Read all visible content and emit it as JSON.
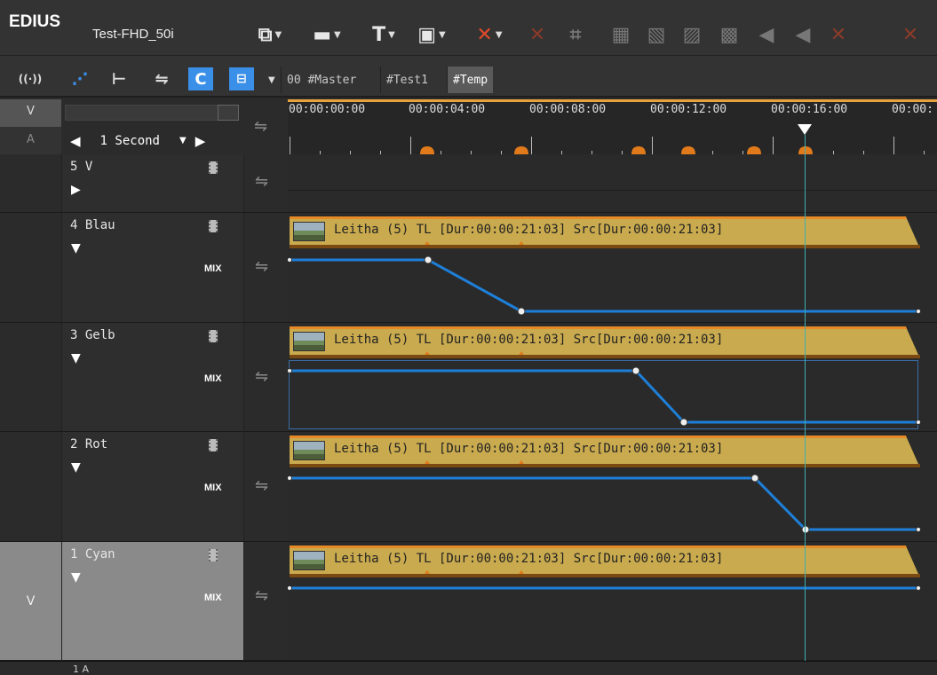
{
  "app": {
    "name": "EDIUS",
    "project": "Test-FHD_50i"
  },
  "toolbar1": {
    "items": [
      {
        "name": "new-sequence-icon",
        "glyph": "⧉",
        "color": "#e8e8e8",
        "dropdown": true
      },
      {
        "name": "open-folder-icon",
        "glyph": "▬",
        "color": "#e8e8e8",
        "dropdown": true
      },
      {
        "name": "title-icon",
        "glyph": "T",
        "color": "#e8e8e8",
        "dropdown": true
      },
      {
        "name": "save-icon",
        "glyph": "▣",
        "color": "#e8e8e8",
        "dropdown": true
      },
      {
        "name": "delete-icon",
        "glyph": "✕",
        "color": "#e04a2a",
        "dropdown": true
      },
      {
        "name": "ripple-delete-icon",
        "glyph": "✕",
        "color": "#8a3a2a",
        "dropdown": false
      },
      {
        "name": "add-cut-icon",
        "glyph": "⌗",
        "color": "#777",
        "dropdown": false
      },
      {
        "name": "delete-video-icon",
        "glyph": "▦",
        "color": "#777",
        "dropdown": false
      },
      {
        "name": "delete-audio-icon",
        "glyph": "▧",
        "color": "#777",
        "dropdown": false
      },
      {
        "name": "delete-transition-icon",
        "glyph": "▨",
        "color": "#777",
        "dropdown": false
      },
      {
        "name": "delete-keyframe-icon",
        "glyph": "▩",
        "color": "#777",
        "dropdown": false
      },
      {
        "name": "mute-icon",
        "glyph": "◀",
        "color": "#777",
        "dropdown": false
      },
      {
        "name": "mute-all-icon",
        "glyph": "◀",
        "color": "#777",
        "dropdown": false
      },
      {
        "name": "remove-x-icon",
        "glyph": "✕",
        "color": "#8a3a2a",
        "dropdown": false
      },
      {
        "name": "remove-x2-icon",
        "glyph": "✕",
        "color": "#8a3a2a",
        "dropdown": false
      }
    ]
  },
  "toolbar2": {
    "items": [
      {
        "name": "wireless-icon",
        "glyph": "((·))",
        "color": "#dcdcdc"
      },
      {
        "name": "ripple-mode-icon",
        "glyph": "⋰",
        "color": "#3a8fe8"
      },
      {
        "name": "trim-icon",
        "glyph": "⊢",
        "color": "#dcdcdc"
      },
      {
        "name": "sync-mode-icon",
        "glyph": "⇋",
        "color": "#dcdcdc"
      },
      {
        "name": "snap-icon",
        "glyph": "C",
        "color": "#3a8fe8"
      },
      {
        "name": "link-icon",
        "glyph": "⊟",
        "color": "#3a8fe8"
      }
    ],
    "tabs": [
      {
        "label": "00 #Master",
        "active": false
      },
      {
        "label": "#Test1",
        "active": false
      },
      {
        "label": "#Temp",
        "active": true
      }
    ]
  },
  "header": {
    "v_label": "V",
    "a_label": "A",
    "scale": "1 Second",
    "ruler_times": [
      "00:00:00:00",
      "00:00:04:00",
      "00:00:08:00",
      "00:00:12:00",
      "00:00:16:00",
      "00:00:"
    ]
  },
  "tracks": [
    {
      "name": "5 V",
      "mix": "",
      "side_label": "",
      "clip": null
    },
    {
      "name": "4 Blau",
      "mix": "MIX",
      "side_label": "",
      "clip": {
        "label": "Leitha (5)  TL [Dur:00:00:21:03]  Src[Dur:00:00:21:03]"
      }
    },
    {
      "name": "3 Gelb",
      "mix": "MIX",
      "side_label": "",
      "clip": {
        "label": "Leitha (5)  TL [Dur:00:00:21:03]  Src[Dur:00:00:21:03]"
      }
    },
    {
      "name": "2 Rot",
      "mix": "MIX",
      "side_label": "",
      "clip": {
        "label": "Leitha (5)  TL [Dur:00:00:21:03]  Src[Dur:00:00:21:03]"
      }
    },
    {
      "name": "1 Cyan",
      "mix": "MIX",
      "side_label": "V",
      "clip": {
        "label": "Leitha (5)  TL [Dur:00:00:21:03]  Src[Dur:00:00:21:03]"
      }
    }
  ],
  "bottom": {
    "left_label": "1 A"
  },
  "colors": {
    "accent": "#3a8fe8",
    "clip": "#c9aa4e",
    "rubberband": "#1e7fd8",
    "playhead": "#3fb0b0",
    "marker": "#e07a1a"
  }
}
